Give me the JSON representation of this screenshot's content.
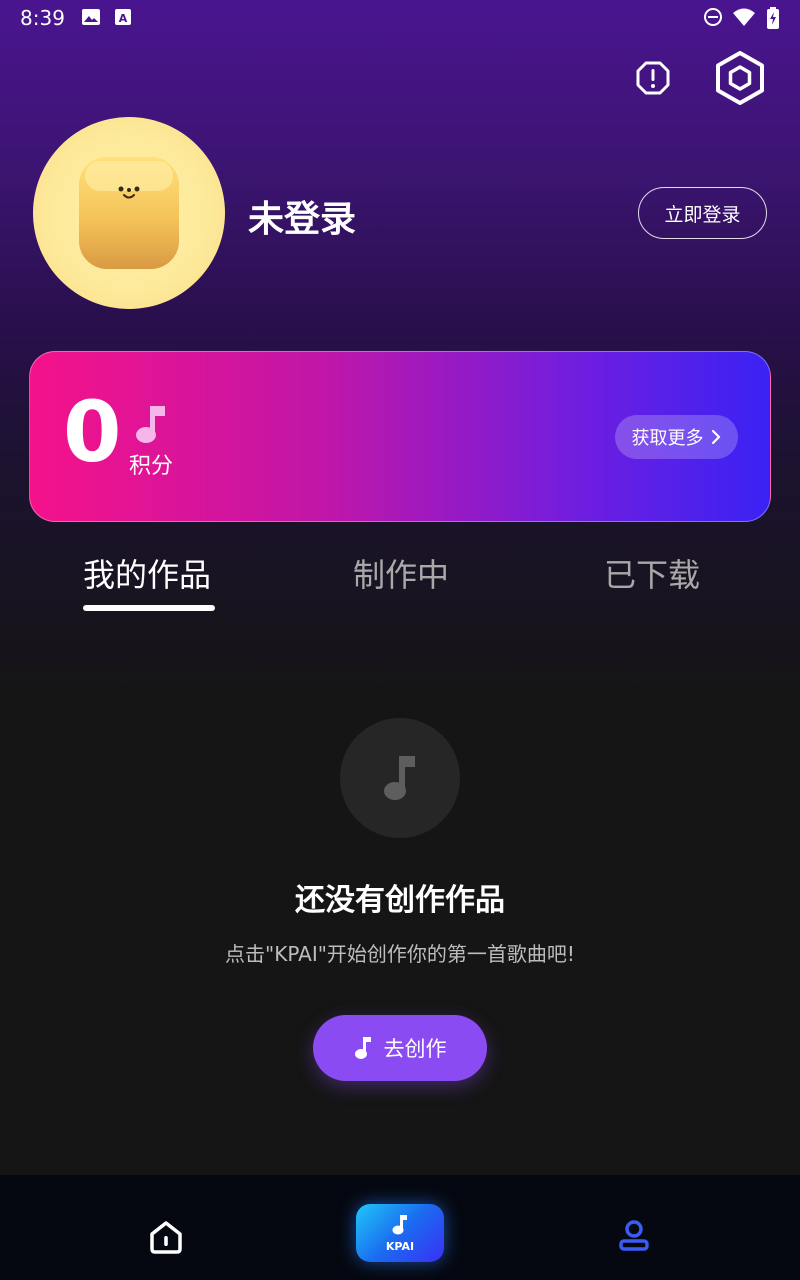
{
  "status_bar": {
    "time": "8:39",
    "icons": [
      "image-icon",
      "a-icon",
      "dnd-icon",
      "wifi-icon",
      "battery-icon"
    ]
  },
  "header": {
    "icons": [
      "alert-octagon-icon",
      "settings-hexagon-icon"
    ]
  },
  "profile": {
    "username": "未登录",
    "login_label": "立即登录"
  },
  "points": {
    "value": "0",
    "label": "积分",
    "more_label": "获取更多"
  },
  "tabs": [
    {
      "label": "我的作品",
      "active": true
    },
    {
      "label": "制作中",
      "active": false
    },
    {
      "label": "已下载",
      "active": false
    }
  ],
  "empty_state": {
    "title": "还没有创作作品",
    "subtitle": "点击\"KPAI\"开始创作你的第一首歌曲吧!",
    "button_label": "去创作"
  },
  "bottom_nav": {
    "items": [
      "home-icon",
      "kpai",
      "profile-icon"
    ],
    "kpai_label": "KPAI"
  },
  "colors": {
    "accent_purple": "#8a4cf2",
    "card_pink": "#f5128a",
    "card_blue": "#3a22f4",
    "nav_active": "#3a5cf5"
  }
}
